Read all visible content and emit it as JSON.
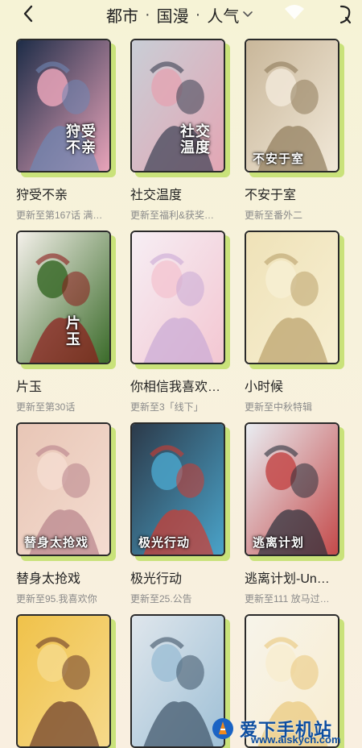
{
  "header": {
    "filters": [
      "都市",
      "国漫",
      "人气"
    ],
    "separator": "·"
  },
  "comics": [
    {
      "name": "狩受不亲",
      "update": "更新至第167话 满…",
      "cover_text": "狩受\n不亲",
      "palette": [
        "#1e2d48",
        "#6f87b4",
        "#e7a3b9"
      ]
    },
    {
      "name": "社交温度",
      "update": "更新至福利&获奖…",
      "cover_text": "社交\n温度",
      "palette": [
        "#c9ced6",
        "#3a3f52",
        "#e3a6b4"
      ]
    },
    {
      "name": "不安于室",
      "update": "更新至番外二",
      "cover_text": "不安于室",
      "palette": [
        "#c9b79a",
        "#8e7a5a",
        "#f1e8d8"
      ]
    },
    {
      "name": "片玉",
      "update": "更新至第30话",
      "cover_text": "片\n玉",
      "palette": [
        "#f4f0ea",
        "#8c1a1a",
        "#3b6b2a"
      ]
    },
    {
      "name": "你相信我喜欢…",
      "update": "更新至3「线下」",
      "cover_text": "",
      "palette": [
        "#f6eef4",
        "#c9a9d6",
        "#f3c7d2"
      ]
    },
    {
      "name": "小时候",
      "update": "更新至中秋特辑",
      "cover_text": "",
      "palette": [
        "#efe2b8",
        "#b9a06a",
        "#f7efd2"
      ]
    },
    {
      "name": "替身太抢戏",
      "update": "更新至95.我喜欢你",
      "cover_text": "替身太抢戏",
      "palette": [
        "#e8c6b6",
        "#b7818a",
        "#f4dcd0"
      ]
    },
    {
      "name": "极光行动",
      "update": "更新至25.公告",
      "cover_text": "极光行动",
      "palette": [
        "#2c3a4a",
        "#d23a2f",
        "#4aa3c9"
      ]
    },
    {
      "name": "逃离计划-Un…",
      "update": "更新至111 放马过…",
      "cover_text": "逃离计划",
      "palette": [
        "#e9edf2",
        "#2a2f3a",
        "#c44a4a"
      ]
    },
    {
      "name": "",
      "update": "",
      "cover_text": "",
      "palette": [
        "#f0c24a",
        "#6a3a2a",
        "#f6d98a"
      ]
    },
    {
      "name": "",
      "update": "",
      "cover_text": "",
      "palette": [
        "#dfe6ec",
        "#3d5266",
        "#9fc0d6"
      ]
    },
    {
      "name": "",
      "update": "",
      "cover_text": "",
      "palette": [
        "#f7f4ea",
        "#e9c77a",
        "#f8edd0"
      ]
    }
  ],
  "watermark": {
    "brand": "爱下手机站",
    "url": "www.aiskycn.com"
  },
  "colors": {
    "card_shadow": "#c9e27a",
    "card_border": "#2a2a2a",
    "update_text": "#8a8a8a"
  },
  "icons": {
    "back": "chevron-left-icon",
    "dropdown": "chevron-down-icon",
    "status": "wifi-icon",
    "right": "search-icon"
  }
}
